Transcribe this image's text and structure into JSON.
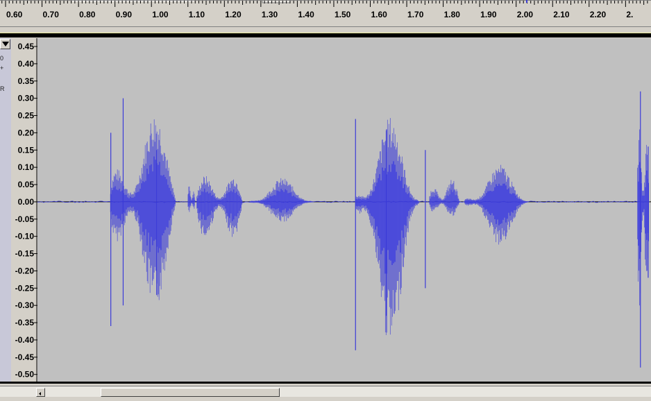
{
  "timeline": {
    "labels": [
      "0.60",
      "0.70",
      "0.80",
      "0.90",
      "1.00",
      "1.10",
      "1.20",
      "1.30",
      "1.40",
      "1.50",
      "1.60",
      "1.70",
      "1.80",
      "1.90",
      "2.00",
      "2.10",
      "2.20",
      "2."
    ]
  },
  "track": {
    "menu_icon": "triangle-down-icon",
    "glyphs": [
      "0",
      "+",
      "R"
    ]
  },
  "chart_data": {
    "type": "line",
    "x_range": [
      0.53,
      2.27
    ],
    "ylim": [
      -0.51,
      0.46
    ],
    "y_tick_labels": [
      "0.45",
      "0.40",
      "0.35",
      "0.30",
      "0.25",
      "0.20",
      "0.15",
      "0.10",
      "0.05",
      "0.00",
      "-0.05",
      "-0.10",
      "-0.15",
      "-0.20",
      "-0.25",
      "-0.30",
      "-0.35",
      "-0.40",
      "-0.45",
      "-0.50"
    ],
    "y_ticks": [
      0.45,
      0.4,
      0.35,
      0.3,
      0.25,
      0.2,
      0.15,
      0.1,
      0.05,
      0.0,
      -0.05,
      -0.1,
      -0.15,
      -0.2,
      -0.25,
      -0.3,
      -0.35,
      -0.4,
      -0.45,
      -0.5
    ],
    "wave_color": "#3a3ad8",
    "wave_fill_color": "#5a5ae0",
    "background_color": "#c0c0c0",
    "bursts": [
      {
        "start": 0.735,
        "end": 0.95,
        "peak_max": 0.3,
        "peak_min": -0.36
      },
      {
        "start": 0.955,
        "end": 0.98,
        "peak_max": 0.08,
        "peak_min": -0.05
      },
      {
        "start": 0.98,
        "end": 1.13,
        "peak_max": 0.12,
        "peak_min": -0.17
      },
      {
        "start": 1.13,
        "end": 1.34,
        "peak_max": 0.07,
        "peak_min": -0.06
      },
      {
        "start": 1.43,
        "end": 1.64,
        "peak_max": 0.25,
        "peak_min": -0.43
      },
      {
        "start": 1.64,
        "end": 1.74,
        "peak_max": 0.09,
        "peak_min": -0.06
      },
      {
        "start": 1.74,
        "end": 1.95,
        "peak_max": 0.11,
        "peak_min": -0.13
      },
      {
        "start": 2.23,
        "end": 2.27,
        "peak_max": 0.32,
        "peak_min": -0.48
      }
    ]
  }
}
